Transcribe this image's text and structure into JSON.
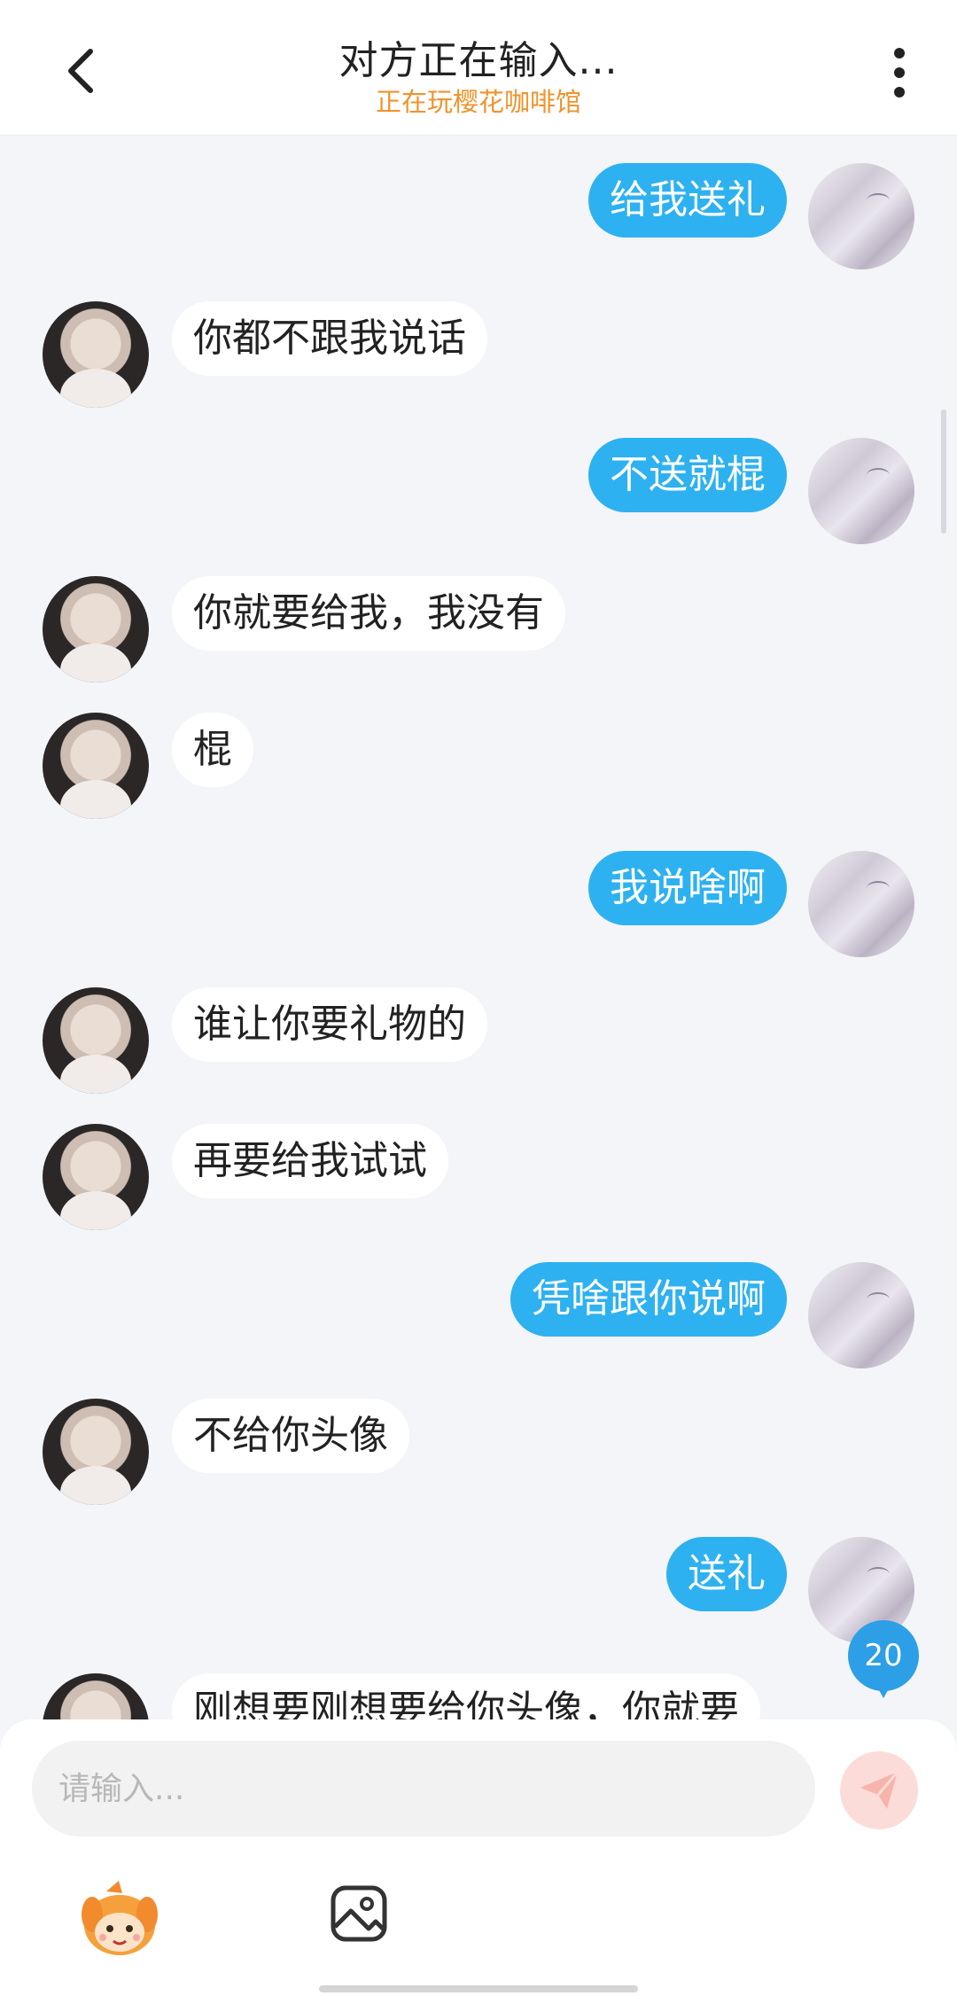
{
  "header": {
    "title": "对方正在输入...",
    "subtitle": "正在玩樱花咖啡馆",
    "subtitle_color": "#f0932b"
  },
  "messages": [
    {
      "side": "out",
      "text": "给我送礼"
    },
    {
      "side": "in",
      "text": "你都不跟我说话"
    },
    {
      "side": "out",
      "text": "不送就棍"
    },
    {
      "side": "in",
      "text": "你就要给我，我没有"
    },
    {
      "side": "in",
      "text": "棍"
    },
    {
      "side": "out",
      "text": "我说啥啊"
    },
    {
      "side": "in",
      "text": "谁让你要礼物的"
    },
    {
      "side": "in",
      "text": "再要给我试试"
    },
    {
      "side": "out",
      "text": "凭啥跟你说啊"
    },
    {
      "side": "in",
      "text": " 不给你头像"
    },
    {
      "side": "out",
      "text": "送礼"
    },
    {
      "side": "in",
      "text": "刚想要刚想要给你头像，你就要"
    }
  ],
  "unread_badge": "20",
  "input": {
    "placeholder": "请输入..."
  },
  "colors": {
    "outgoing_bubble": "#2eb1f0",
    "incoming_bubble": "#ffffff",
    "background": "#f3f5f8",
    "send_button": "#fcdcd8"
  },
  "icons": {
    "back": "chevron-left-icon",
    "more": "more-vertical-icon",
    "send": "paper-plane-icon",
    "mascot": "mascot-icon",
    "image": "image-icon"
  }
}
